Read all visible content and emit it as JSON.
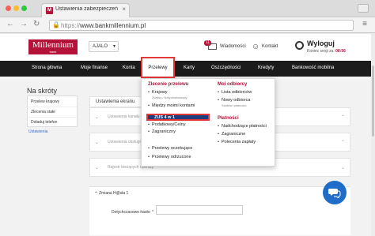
{
  "browser": {
    "tab_title": "Ustawienia zabezpieczeń",
    "tab_favicon_letter": "M",
    "url_scheme": "https://",
    "url_host": "www.bankmillennium.pl"
  },
  "header": {
    "logo_text": "Millennium",
    "logo_sub": "bank",
    "language": "AJALO",
    "messages_label": "Wiadomości",
    "messages_count": "11",
    "contact_label": "Kontakt",
    "logout_label": "Wyloguj",
    "session_label": "Koniec sesji za:",
    "session_time": "08:56"
  },
  "nav": {
    "items": [
      "Strona główna",
      "Moje finanse",
      "Konta",
      "Przelewy",
      "Karty",
      "Oszczędności",
      "Kredyty",
      "Bankowość mobilna"
    ],
    "active": "Przelewy"
  },
  "sidebar": {
    "title": "Na skróty",
    "links": [
      "Przelew krajowy",
      "Zlecenia stałe",
      "Doładuj telefon"
    ],
    "section": "Ustawienia"
  },
  "main": {
    "header": "Ustawienia ekranu",
    "panel1_text": "Ustawienia kanału",
    "panel2_text": "Ustawienia obsługi",
    "panel3_text": "Rejestr bieżących operacji",
    "zmiana_title": "Zmiana H@sła 1",
    "field_label": "Dotychczasowe hasło: *"
  },
  "dropdown": {
    "col1_head": "Zlecenie przelewu",
    "col1_items": [
      "Krajowy",
      "Między moimi kontami",
      "ZUS 4 w 1",
      "Podatkowy/Celny",
      "Zagraniczny"
    ],
    "col1_sub": "Zwykły / Natychmiastowy",
    "col1_bottom": [
      "Przelewy oczekujące",
      "Przelewy odrzucone"
    ],
    "col2_head": "Moi odbiorcy",
    "col2_items": [
      "Lista odbiorców",
      "Nowy odbiorca"
    ],
    "col2_sub": "Szablon płatności",
    "col3_head": "Płatności",
    "col3_items": [
      "Nadchodzące płatności",
      "Zagraniczne",
      "Polecenia zapłaty"
    ]
  },
  "colors": {
    "brand": "#b5123a",
    "nav_bg": "#1b1b1b",
    "highlight": "#1f3d7a",
    "annotation": "#e23838",
    "chat": "#1f6dc8"
  }
}
